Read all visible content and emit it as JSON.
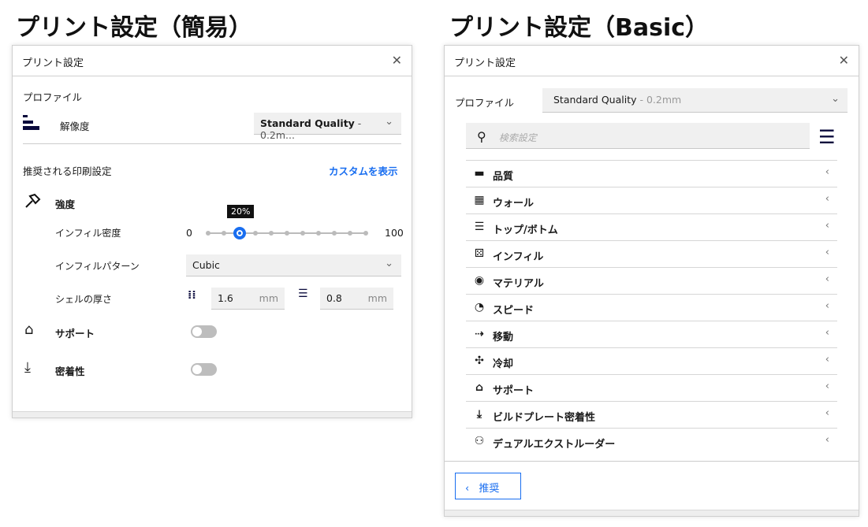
{
  "left": {
    "heading": "プリント設定（簡易）",
    "window_title": "プリント設定",
    "profile_label": "プロファイル",
    "resolution_label": "解像度",
    "profile_value": "Standard Quality",
    "profile_suffix": " - 0.2m...",
    "recommended_label": "推奨される印刷設定",
    "custom_link": "カスタムを表示",
    "strength_label": "強度",
    "infill_density_label": "インフィル密度",
    "slider_min": "0",
    "slider_max": "100",
    "slider_value": 20,
    "slider_tooltip": "20%",
    "infill_pattern_label": "インフィルパターン",
    "infill_pattern_value": "Cubic",
    "shell_label": "シェルの厚さ",
    "wall_thickness": "1.6",
    "top_bottom_thickness": "0.8",
    "unit": "mm",
    "support_label": "サポート",
    "support_enabled": false,
    "adhesion_label": "密着性",
    "adhesion_enabled": false
  },
  "right": {
    "heading": "プリント設定（Basic）",
    "window_title": "プリント設定",
    "profile_label": "プロファイル",
    "profile_value": "Standard Quality",
    "profile_suffix": " - 0.2mm",
    "search_placeholder": "検索設定",
    "categories": [
      {
        "label": "品質",
        "icon": "quality-icon"
      },
      {
        "label": "ウォール",
        "icon": "wall-icon"
      },
      {
        "label": "トップ/ボトム",
        "icon": "top-bottom-icon"
      },
      {
        "label": "インフィル",
        "icon": "infill-icon"
      },
      {
        "label": "マテリアル",
        "icon": "material-icon"
      },
      {
        "label": "スピード",
        "icon": "speed-icon"
      },
      {
        "label": "移動",
        "icon": "travel-icon"
      },
      {
        "label": "冷却",
        "icon": "fan-icon"
      },
      {
        "label": "サポート",
        "icon": "support-icon"
      },
      {
        "label": "ビルドプレート密着性",
        "icon": "adhesion-icon"
      },
      {
        "label": "デュアルエクストルーダー",
        "icon": "dual-extruder-icon"
      }
    ],
    "recommended_button": "推奨"
  },
  "colors": {
    "accent": "#196ef0",
    "dark_icon": "#0a0a3c"
  }
}
